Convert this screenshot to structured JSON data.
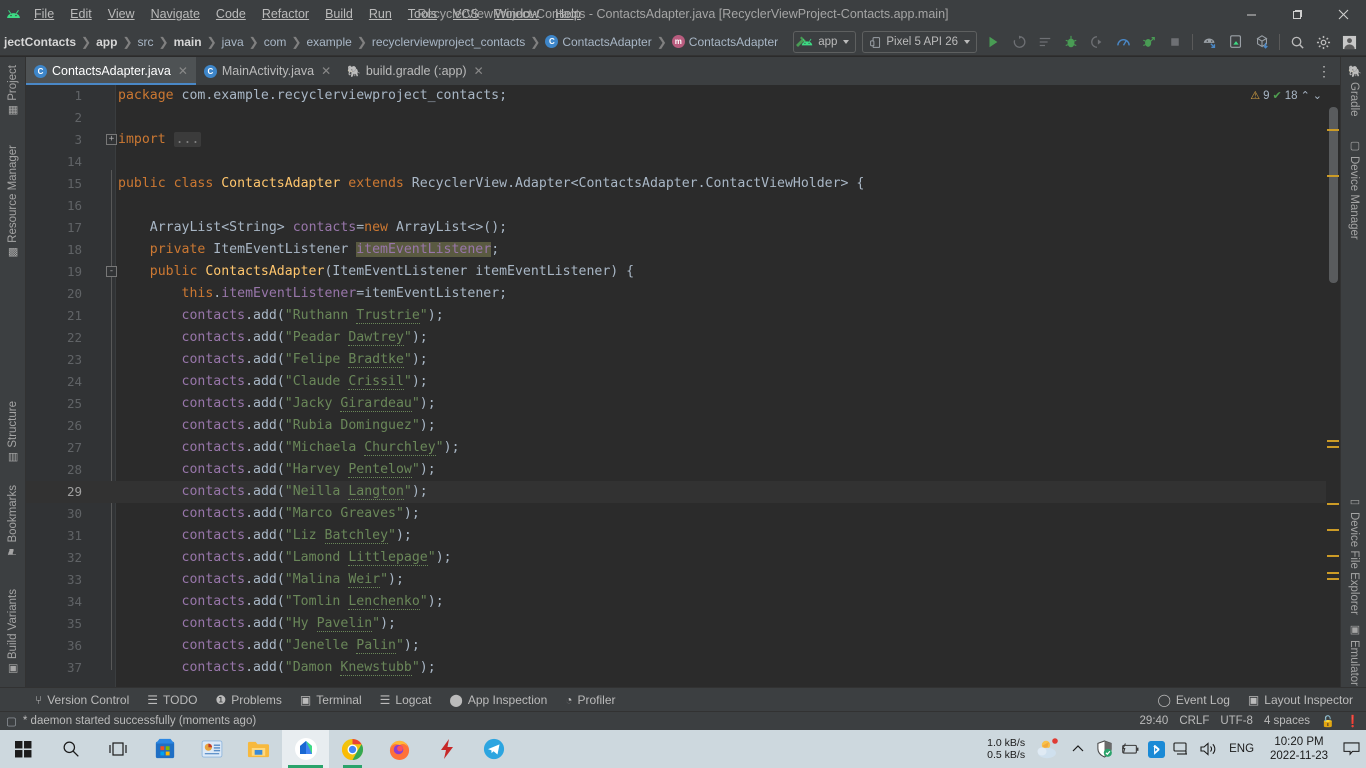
{
  "window": {
    "title": "RecyclerViewProject-Contacts - ContactsAdapter.java [RecyclerViewProject-Contacts.app.main]",
    "minimize": "—",
    "maximize": "❐",
    "close": "✕"
  },
  "menu": {
    "items": [
      "File",
      "Edit",
      "View",
      "Navigate",
      "Code",
      "Refactor",
      "Build",
      "Run",
      "Tools",
      "VCS",
      "Window",
      "Help"
    ]
  },
  "breadcrumbs": [
    {
      "label": "jectContacts",
      "bold": true,
      "icon": ""
    },
    {
      "label": "app",
      "bold": true,
      "icon": ""
    },
    {
      "label": "src",
      "bold": false,
      "icon": ""
    },
    {
      "label": "main",
      "bold": true,
      "icon": ""
    },
    {
      "label": "java",
      "bold": false,
      "icon": ""
    },
    {
      "label": "com",
      "bold": false,
      "icon": ""
    },
    {
      "label": "example",
      "bold": false,
      "icon": ""
    },
    {
      "label": "recyclerviewproject_contacts",
      "bold": false,
      "icon": ""
    },
    {
      "label": "ContactsAdapter",
      "bold": false,
      "icon": "c"
    },
    {
      "label": "ContactsAdapter",
      "bold": false,
      "icon": "m"
    }
  ],
  "toolbar": {
    "module_selector": "app",
    "device_selector": "Pixel 5 API 26",
    "run_title": "Run",
    "debug_title": "Debug",
    "stop_title": "Stop",
    "search_title": "Search Everywhere",
    "settings_title": "Settings",
    "account_title": "Account"
  },
  "left_strip": [
    {
      "label": "Project",
      "icon": "▦"
    },
    {
      "label": "Resource Manager",
      "icon": "▩"
    },
    {
      "label": "Structure",
      "icon": "▤"
    },
    {
      "label": "Bookmarks",
      "icon": "⚑"
    },
    {
      "label": "Build Variants",
      "icon": "▣"
    }
  ],
  "right_strip": [
    {
      "label": "Gradle",
      "icon": "🐘"
    },
    {
      "label": "Device Manager",
      "icon": "▢"
    },
    {
      "label": "Device File Explorer",
      "icon": "▭"
    },
    {
      "label": "Emulator",
      "icon": "▣"
    }
  ],
  "tabs": [
    {
      "label": "ContactsAdapter.java",
      "icon": "c",
      "active": true
    },
    {
      "label": "MainActivity.java",
      "icon": "c",
      "active": false
    },
    {
      "label": "build.gradle (:app)",
      "icon": "g",
      "active": false
    }
  ],
  "inspection": {
    "warnings": "9",
    "checks": "18",
    "warn_icon": "⚠",
    "check_icon": "✓",
    "up_icon": "⌃",
    "down_icon": "⌄"
  },
  "code": {
    "lines": [
      {
        "num": "1",
        "indent": 0,
        "tokens": [
          {
            "t": "package ",
            "c": "kw"
          },
          {
            "t": "com.example.recyclerviewproject_contacts",
            "c": "pln"
          },
          {
            "t": ";",
            "c": "pln"
          }
        ]
      },
      {
        "num": "2",
        "indent": 0,
        "tokens": []
      },
      {
        "num": "3",
        "indent": 0,
        "fold": "+",
        "tokens": [
          {
            "t": "import ",
            "c": "kw"
          },
          {
            "t": "...",
            "c": "folded"
          }
        ]
      },
      {
        "num": "14",
        "indent": 0,
        "tokens": []
      },
      {
        "num": "15",
        "indent": 0,
        "tokens": [
          {
            "t": "public ",
            "c": "kw"
          },
          {
            "t": "class ",
            "c": "kw"
          },
          {
            "t": "ContactsAdapter ",
            "c": "cls"
          },
          {
            "t": "extends ",
            "c": "kw"
          },
          {
            "t": "RecyclerView.Adapter<ContactsAdapter.ContactViewHolder> {",
            "c": "pln"
          }
        ]
      },
      {
        "num": "16",
        "indent": 0,
        "tokens": []
      },
      {
        "num": "17",
        "indent": 1,
        "tokens": [
          {
            "t": "ArrayList<String> ",
            "c": "pln"
          },
          {
            "t": "contacts",
            "c": "fld"
          },
          {
            "t": "=",
            "c": "pln"
          },
          {
            "t": "new ",
            "c": "kw"
          },
          {
            "t": "ArrayList<>();",
            "c": "pln"
          }
        ]
      },
      {
        "num": "18",
        "indent": 1,
        "tokens": [
          {
            "t": "private ",
            "c": "kw"
          },
          {
            "t": "ItemEventListener ",
            "c": "pln"
          },
          {
            "t": "itemEventListener",
            "c": "fld hl"
          },
          {
            "t": ";",
            "c": "pln"
          }
        ]
      },
      {
        "num": "19",
        "indent": 1,
        "fold": "-",
        "tokens": [
          {
            "t": "public ",
            "c": "kw"
          },
          {
            "t": "ContactsAdapter",
            "c": "cls"
          },
          {
            "t": "(ItemEventListener itemEventListener) {",
            "c": "pln"
          }
        ]
      },
      {
        "num": "20",
        "indent": 2,
        "tokens": [
          {
            "t": "this",
            "c": "kw"
          },
          {
            "t": ".",
            "c": "pln"
          },
          {
            "t": "itemEventListener",
            "c": "fld"
          },
          {
            "t": "=itemEventListener;",
            "c": "pln"
          }
        ]
      },
      {
        "num": "21",
        "indent": 2,
        "tokens": [
          {
            "t": "contacts",
            "c": "fld"
          },
          {
            "t": ".",
            "c": "pln"
          },
          {
            "t": "add",
            "c": "pln"
          },
          {
            "t": "(",
            "c": "pln"
          },
          {
            "t": "\"Ruthann ",
            "c": "str"
          },
          {
            "t": "Trustrie",
            "c": "str typo"
          },
          {
            "t": "\"",
            "c": "str"
          },
          {
            "t": ");",
            "c": "pln"
          }
        ]
      },
      {
        "num": "22",
        "indent": 2,
        "tokens": [
          {
            "t": "contacts",
            "c": "fld"
          },
          {
            "t": ".",
            "c": "pln"
          },
          {
            "t": "add",
            "c": "pln"
          },
          {
            "t": "(",
            "c": "pln"
          },
          {
            "t": "\"Peadar ",
            "c": "str"
          },
          {
            "t": "Dawtrey",
            "c": "str typo"
          },
          {
            "t": "\"",
            "c": "str"
          },
          {
            "t": ");",
            "c": "pln"
          }
        ]
      },
      {
        "num": "23",
        "indent": 2,
        "tokens": [
          {
            "t": "contacts",
            "c": "fld"
          },
          {
            "t": ".",
            "c": "pln"
          },
          {
            "t": "add",
            "c": "pln"
          },
          {
            "t": "(",
            "c": "pln"
          },
          {
            "t": "\"Felipe ",
            "c": "str"
          },
          {
            "t": "Bradtke",
            "c": "str typo"
          },
          {
            "t": "\"",
            "c": "str"
          },
          {
            "t": ");",
            "c": "pln"
          }
        ]
      },
      {
        "num": "24",
        "indent": 2,
        "tokens": [
          {
            "t": "contacts",
            "c": "fld"
          },
          {
            "t": ".",
            "c": "pln"
          },
          {
            "t": "add",
            "c": "pln"
          },
          {
            "t": "(",
            "c": "pln"
          },
          {
            "t": "\"Claude ",
            "c": "str"
          },
          {
            "t": "Crissil",
            "c": "str typo"
          },
          {
            "t": "\"",
            "c": "str"
          },
          {
            "t": ");",
            "c": "pln"
          }
        ]
      },
      {
        "num": "25",
        "indent": 2,
        "tokens": [
          {
            "t": "contacts",
            "c": "fld"
          },
          {
            "t": ".",
            "c": "pln"
          },
          {
            "t": "add",
            "c": "pln"
          },
          {
            "t": "(",
            "c": "pln"
          },
          {
            "t": "\"Jacky ",
            "c": "str"
          },
          {
            "t": "Girardeau",
            "c": "str typo"
          },
          {
            "t": "\"",
            "c": "str"
          },
          {
            "t": ");",
            "c": "pln"
          }
        ]
      },
      {
        "num": "26",
        "indent": 2,
        "tokens": [
          {
            "t": "contacts",
            "c": "fld"
          },
          {
            "t": ".",
            "c": "pln"
          },
          {
            "t": "add",
            "c": "pln"
          },
          {
            "t": "(",
            "c": "pln"
          },
          {
            "t": "\"Rubia Dominguez\"",
            "c": "str"
          },
          {
            "t": ");",
            "c": "pln"
          }
        ]
      },
      {
        "num": "27",
        "indent": 2,
        "tokens": [
          {
            "t": "contacts",
            "c": "fld"
          },
          {
            "t": ".",
            "c": "pln"
          },
          {
            "t": "add",
            "c": "pln"
          },
          {
            "t": "(",
            "c": "pln"
          },
          {
            "t": "\"Michaela ",
            "c": "str"
          },
          {
            "t": "Churchley",
            "c": "str typo"
          },
          {
            "t": "\"",
            "c": "str"
          },
          {
            "t": ");",
            "c": "pln"
          }
        ]
      },
      {
        "num": "28",
        "indent": 2,
        "tokens": [
          {
            "t": "contacts",
            "c": "fld"
          },
          {
            "t": ".",
            "c": "pln"
          },
          {
            "t": "add",
            "c": "pln"
          },
          {
            "t": "(",
            "c": "pln"
          },
          {
            "t": "\"Harvey ",
            "c": "str"
          },
          {
            "t": "Pentelow",
            "c": "str typo"
          },
          {
            "t": "\"",
            "c": "str"
          },
          {
            "t": ");",
            "c": "pln"
          }
        ]
      },
      {
        "num": "29",
        "indent": 2,
        "current": true,
        "tokens": [
          {
            "t": "contacts",
            "c": "fld"
          },
          {
            "t": ".",
            "c": "pln"
          },
          {
            "t": "add",
            "c": "pln"
          },
          {
            "t": "(",
            "c": "pln"
          },
          {
            "t": "\"Neilla ",
            "c": "str"
          },
          {
            "t": "Langton",
            "c": "str typo"
          },
          {
            "t": "\"",
            "c": "str"
          },
          {
            "t": ");",
            "c": "pln"
          }
        ]
      },
      {
        "num": "30",
        "indent": 2,
        "tokens": [
          {
            "t": "contacts",
            "c": "fld"
          },
          {
            "t": ".",
            "c": "pln"
          },
          {
            "t": "add",
            "c": "pln"
          },
          {
            "t": "(",
            "c": "pln"
          },
          {
            "t": "\"Marco Greaves\"",
            "c": "str"
          },
          {
            "t": ");",
            "c": "pln"
          }
        ]
      },
      {
        "num": "31",
        "indent": 2,
        "tokens": [
          {
            "t": "contacts",
            "c": "fld"
          },
          {
            "t": ".",
            "c": "pln"
          },
          {
            "t": "add",
            "c": "pln"
          },
          {
            "t": "(",
            "c": "pln"
          },
          {
            "t": "\"Liz ",
            "c": "str"
          },
          {
            "t": "Batchley",
            "c": "str typo"
          },
          {
            "t": "\"",
            "c": "str"
          },
          {
            "t": ");",
            "c": "pln"
          }
        ]
      },
      {
        "num": "32",
        "indent": 2,
        "tokens": [
          {
            "t": "contacts",
            "c": "fld"
          },
          {
            "t": ".",
            "c": "pln"
          },
          {
            "t": "add",
            "c": "pln"
          },
          {
            "t": "(",
            "c": "pln"
          },
          {
            "t": "\"Lamond ",
            "c": "str"
          },
          {
            "t": "Littlepage",
            "c": "str typo"
          },
          {
            "t": "\"",
            "c": "str"
          },
          {
            "t": ");",
            "c": "pln"
          }
        ]
      },
      {
        "num": "33",
        "indent": 2,
        "tokens": [
          {
            "t": "contacts",
            "c": "fld"
          },
          {
            "t": ".",
            "c": "pln"
          },
          {
            "t": "add",
            "c": "pln"
          },
          {
            "t": "(",
            "c": "pln"
          },
          {
            "t": "\"Malina ",
            "c": "str"
          },
          {
            "t": "Weir",
            "c": "str typo"
          },
          {
            "t": "\"",
            "c": "str"
          },
          {
            "t": ");",
            "c": "pln"
          }
        ]
      },
      {
        "num": "34",
        "indent": 2,
        "tokens": [
          {
            "t": "contacts",
            "c": "fld"
          },
          {
            "t": ".",
            "c": "pln"
          },
          {
            "t": "add",
            "c": "pln"
          },
          {
            "t": "(",
            "c": "pln"
          },
          {
            "t": "\"Tomlin ",
            "c": "str"
          },
          {
            "t": "Lenchenko",
            "c": "str typo"
          },
          {
            "t": "\"",
            "c": "str"
          },
          {
            "t": ");",
            "c": "pln"
          }
        ]
      },
      {
        "num": "35",
        "indent": 2,
        "tokens": [
          {
            "t": "contacts",
            "c": "fld"
          },
          {
            "t": ".",
            "c": "pln"
          },
          {
            "t": "add",
            "c": "pln"
          },
          {
            "t": "(",
            "c": "pln"
          },
          {
            "t": "\"Hy ",
            "c": "str"
          },
          {
            "t": "Pavelin",
            "c": "str typo"
          },
          {
            "t": "\"",
            "c": "str"
          },
          {
            "t": ");",
            "c": "pln"
          }
        ]
      },
      {
        "num": "36",
        "indent": 2,
        "tokens": [
          {
            "t": "contacts",
            "c": "fld"
          },
          {
            "t": ".",
            "c": "pln"
          },
          {
            "t": "add",
            "c": "pln"
          },
          {
            "t": "(",
            "c": "pln"
          },
          {
            "t": "\"Jenelle ",
            "c": "str"
          },
          {
            "t": "Palin",
            "c": "str typo"
          },
          {
            "t": "\"",
            "c": "str"
          },
          {
            "t": ");",
            "c": "pln"
          }
        ]
      },
      {
        "num": "37",
        "indent": 2,
        "tokens": [
          {
            "t": "contacts",
            "c": "fld"
          },
          {
            "t": ".",
            "c": "pln"
          },
          {
            "t": "add",
            "c": "pln"
          },
          {
            "t": "(",
            "c": "pln"
          },
          {
            "t": "\"Damon ",
            "c": "str"
          },
          {
            "t": "Knewstubb",
            "c": "str typo"
          },
          {
            "t": "\"",
            "c": "str"
          },
          {
            "t": ");",
            "c": "pln"
          }
        ]
      }
    ]
  },
  "tool_windows": [
    {
      "label": "Version Control",
      "icon": "⑂"
    },
    {
      "label": "TODO",
      "icon": "☰"
    },
    {
      "label": "Problems",
      "icon": "❗"
    },
    {
      "label": "Terminal",
      "icon": "▣"
    },
    {
      "label": "Logcat",
      "icon": "☰"
    },
    {
      "label": "App Inspection",
      "icon": "⬤"
    },
    {
      "label": "Profiler",
      "icon": "◔"
    }
  ],
  "tool_windows_right": [
    {
      "label": "Event Log",
      "icon": "◯"
    },
    {
      "label": "Layout Inspector",
      "icon": "▣"
    }
  ],
  "status": {
    "message": "* daemon started successfully (moments ago)",
    "caret": "29:40",
    "line_sep": "CRLF",
    "encoding": "UTF-8",
    "indent": "4 spaces",
    "lock_icon": "🔒",
    "notif_icon": "❗"
  },
  "taskbar": {
    "icons": [
      {
        "name": "start-button"
      },
      {
        "name": "search-icon"
      },
      {
        "name": "task-view-icon"
      },
      {
        "name": "microsoft-store-icon"
      },
      {
        "name": "powerpoint-icon"
      },
      {
        "name": "file-explorer-icon"
      },
      {
        "name": "android-studio-icon"
      },
      {
        "name": "chrome-icon"
      },
      {
        "name": "firefox-icon"
      },
      {
        "name": "flash-icon"
      },
      {
        "name": "telegram-icon"
      }
    ],
    "net_up": "1.0 kB/s",
    "net_down": "0.5 kB/s",
    "language": "ENG",
    "time": "10:20 PM",
    "date": "2022-11-23"
  }
}
